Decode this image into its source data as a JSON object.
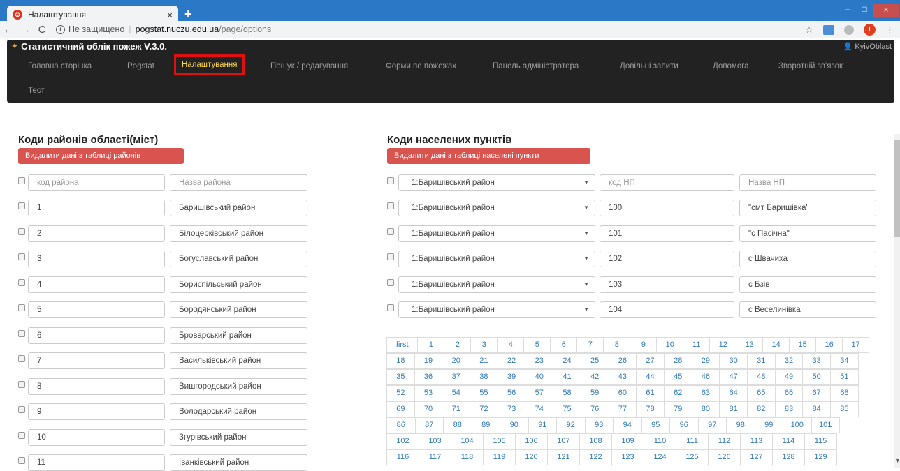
{
  "browser": {
    "tab_title": "Налаштування",
    "close_glyph": "×",
    "new_tab_glyph": "+",
    "min_glyph": "–",
    "max_glyph": "□",
    "win_close_glyph": "×",
    "back": "←",
    "forward": "→",
    "reload": "C",
    "info_glyph": "i",
    "insecure_label": "Не защищено",
    "separator": "|",
    "url_host": "pogstat.nuczu.edu.ua",
    "url_path": "/page/options",
    "star": "☆",
    "profile_initial": "T",
    "menu": "⋮"
  },
  "app": {
    "title": "Статистичний облік пожеж V.3.0.",
    "user": "KyivOblast",
    "nav": [
      "Головна сторінка",
      "Pogstat",
      "Налаштування",
      "Пошук / редагування",
      "Форми по пожежах",
      "Панель адміністратора",
      "Довільні запити",
      "Допомога",
      "Зворотній зв'язок",
      "Тест"
    ]
  },
  "districts": {
    "title": "Коди районів області(міст)",
    "delete_button": "Видалити дані з таблиці районів",
    "code_placeholder": "код района",
    "name_placeholder": "Назва района",
    "rows": [
      {
        "code": "1",
        "name": "Баришівський район"
      },
      {
        "code": "2",
        "name": "Білоцерківський район"
      },
      {
        "code": "3",
        "name": "Богуславський район"
      },
      {
        "code": "4",
        "name": "Бориспільський район"
      },
      {
        "code": "5",
        "name": "Бородянський район"
      },
      {
        "code": "6",
        "name": "Броварський район"
      },
      {
        "code": "7",
        "name": "Васильківський район"
      },
      {
        "code": "8",
        "name": "Вишгородський район"
      },
      {
        "code": "9",
        "name": "Володарський район"
      },
      {
        "code": "10",
        "name": "Згурівський район"
      },
      {
        "code": "11",
        "name": "Іванківський район"
      }
    ]
  },
  "settlements": {
    "title": "Коди населених пунктів",
    "delete_button": "Видалити дані з таблиці населені пункти",
    "district_select": "1:Баришівський район",
    "code_placeholder": "код НП",
    "name_placeholder": "Назва НП",
    "rows": [
      {
        "district": "1:Баришівський район",
        "code": "100",
        "name": "\"смт Баришівка\""
      },
      {
        "district": "1:Баришівський район",
        "code": "101",
        "name": "\"с Пасічна\""
      },
      {
        "district": "1:Баришівський район",
        "code": "102",
        "name": "с Швачиха"
      },
      {
        "district": "1:Баришівський район",
        "code": "103",
        "name": "с Бзів"
      },
      {
        "district": "1:Баришівський район",
        "code": "104",
        "name": "с Веселинівка"
      }
    ]
  },
  "pagination": {
    "rows": [
      [
        "first",
        "1",
        "2",
        "3",
        "4",
        "5",
        "6",
        "7",
        "8",
        "9",
        "10",
        "11",
        "12",
        "13",
        "14",
        "15",
        "16",
        "17"
      ],
      [
        "18",
        "19",
        "20",
        "21",
        "22",
        "23",
        "24",
        "25",
        "26",
        "27",
        "28",
        "29",
        "30",
        "31",
        "32",
        "33",
        "34"
      ],
      [
        "35",
        "36",
        "37",
        "38",
        "39",
        "40",
        "41",
        "42",
        "43",
        "44",
        "45",
        "46",
        "47",
        "48",
        "49",
        "50",
        "51"
      ],
      [
        "52",
        "53",
        "54",
        "55",
        "56",
        "57",
        "58",
        "59",
        "60",
        "61",
        "62",
        "63",
        "64",
        "65",
        "66",
        "67",
        "68"
      ],
      [
        "69",
        "70",
        "71",
        "72",
        "73",
        "74",
        "75",
        "76",
        "77",
        "78",
        "79",
        "80",
        "81",
        "82",
        "83",
        "84",
        "85"
      ],
      [
        "86",
        "87",
        "88",
        "89",
        "90",
        "91",
        "92",
        "93",
        "94",
        "95",
        "96",
        "97",
        "98",
        "99",
        "100",
        "101"
      ],
      [
        "102",
        "103",
        "104",
        "105",
        "106",
        "107",
        "108",
        "109",
        "110",
        "111",
        "112",
        "113",
        "114",
        "115"
      ],
      [
        "116",
        "117",
        "118",
        "119",
        "120",
        "121",
        "122",
        "123",
        "124",
        "125",
        "126",
        "127",
        "128",
        "129"
      ]
    ]
  }
}
